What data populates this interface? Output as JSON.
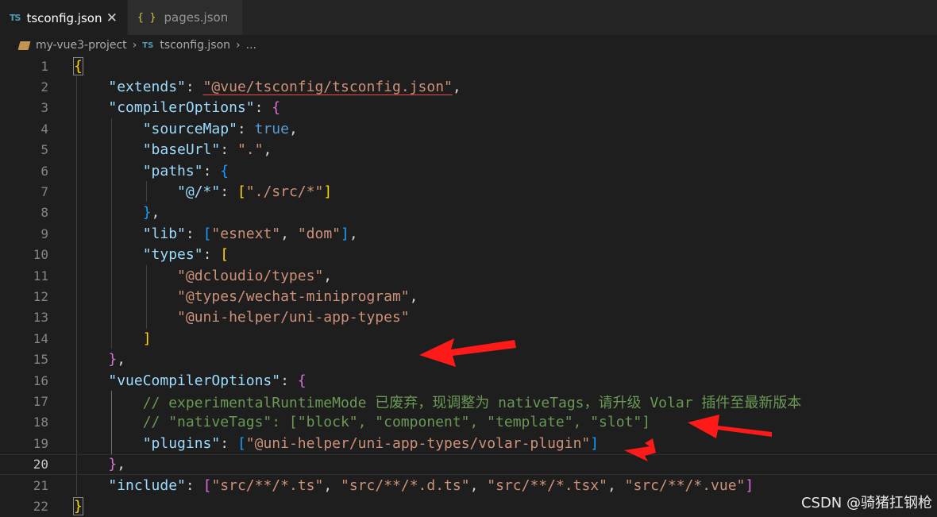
{
  "tabs": [
    {
      "icon": "TS",
      "label": "tsconfig.json",
      "active": true,
      "close": "✕"
    },
    {
      "icon": "{ }",
      "label": "pages.json",
      "active": false
    }
  ],
  "breadcrumb": {
    "project": "my-vue3-project",
    "file_icon": "TS",
    "file": "tsconfig.json",
    "more": "..."
  },
  "editor": {
    "current_line": 20,
    "lines": [
      {
        "n": "1"
      },
      {
        "n": "2"
      },
      {
        "n": "3"
      },
      {
        "n": "4"
      },
      {
        "n": "5"
      },
      {
        "n": "6"
      },
      {
        "n": "7"
      },
      {
        "n": "8"
      },
      {
        "n": "9"
      },
      {
        "n": "10"
      },
      {
        "n": "11"
      },
      {
        "n": "12"
      },
      {
        "n": "13"
      },
      {
        "n": "14"
      },
      {
        "n": "15"
      },
      {
        "n": "16"
      },
      {
        "n": "17"
      },
      {
        "n": "18"
      },
      {
        "n": "19"
      },
      {
        "n": "20"
      },
      {
        "n": "21"
      },
      {
        "n": "22"
      }
    ],
    "text": {
      "k_extends": "\"extends\"",
      "s_extends": "\"@vue/tsconfig/tsconfig.json\"",
      "k_compilerOptions": "\"compilerOptions\"",
      "k_sourceMap": "\"sourceMap\"",
      "v_true": "true",
      "k_baseUrl": "\"baseUrl\"",
      "s_dot": "\".\"",
      "k_paths": "\"paths\"",
      "k_alias": "\"@/*\"",
      "s_src": "\"./src/*\"",
      "k_lib": "\"lib\"",
      "s_esnext": "\"esnext\"",
      "s_dom": "\"dom\"",
      "k_types": "\"types\"",
      "s_t1": "\"@dcloudio/types\"",
      "s_t2": "\"@types/wechat-miniprogram\"",
      "s_t3": "\"@uni-helper/uni-app-types\"",
      "k_vueCompilerOptions": "\"vueCompilerOptions\"",
      "comment_17": "// experimentalRuntimeMode 已废弃，现调整为 nativeTags，请升级 Volar 插件至最新版本",
      "comment_18": "// \"nativeTags\": [\"block\", \"component\", \"template\", \"slot\"]",
      "k_plugins": "\"plugins\"",
      "s_plugin": "\"@uni-helper/uni-app-types/volar-plugin\"",
      "k_include": "\"include\"",
      "s_i1": "\"src/**/*.ts\"",
      "s_i2": "\"src/**/*.d.ts\"",
      "s_i3": "\"src/**/*.tsx\"",
      "s_i4": "\"src/**/*.vue\""
    }
  },
  "watermark": "CSDN @骑猪扛钢枪",
  "colors": {
    "key": "#9cdcfe",
    "string": "#ce9178",
    "keyword": "#569cd6",
    "comment": "#6a9955",
    "bracket_gold": "#ffd700",
    "bracket_purple": "#da70d6",
    "bracket_blue": "#179fff",
    "arrow": "#ff1a1a"
  },
  "icons": [
    "typescript-icon",
    "json-icon",
    "close-icon",
    "folder-icon",
    "chevron-right-icon"
  ]
}
